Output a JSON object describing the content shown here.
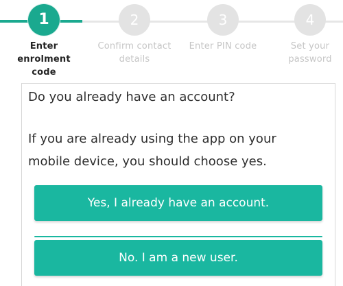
{
  "stepper": {
    "steps": [
      {
        "number": "1",
        "label_line1": "Enter",
        "label_line2": "enrolment",
        "label_line3": "code",
        "active": true
      },
      {
        "number": "2",
        "label_line1": "Confirm contact",
        "label_line2": "details",
        "active": false
      },
      {
        "number": "3",
        "label_line1": "Enter PIN code",
        "active": false
      },
      {
        "number": "4",
        "label_line1": "Set your",
        "label_line2": "password",
        "active": false
      }
    ]
  },
  "card": {
    "question": "Do you already have an account?",
    "explanation_line1": "If you are already using the app on your",
    "explanation_line2": "mobile device, you should choose yes.",
    "yes_button": "Yes, I already have an account.",
    "no_button": "No. I am a new user."
  },
  "colors": {
    "accent": "#1aa98f",
    "button": "#1ab7a0",
    "inactive_step": "#e3e3e3",
    "inactive_label": "#c5c5c5"
  }
}
